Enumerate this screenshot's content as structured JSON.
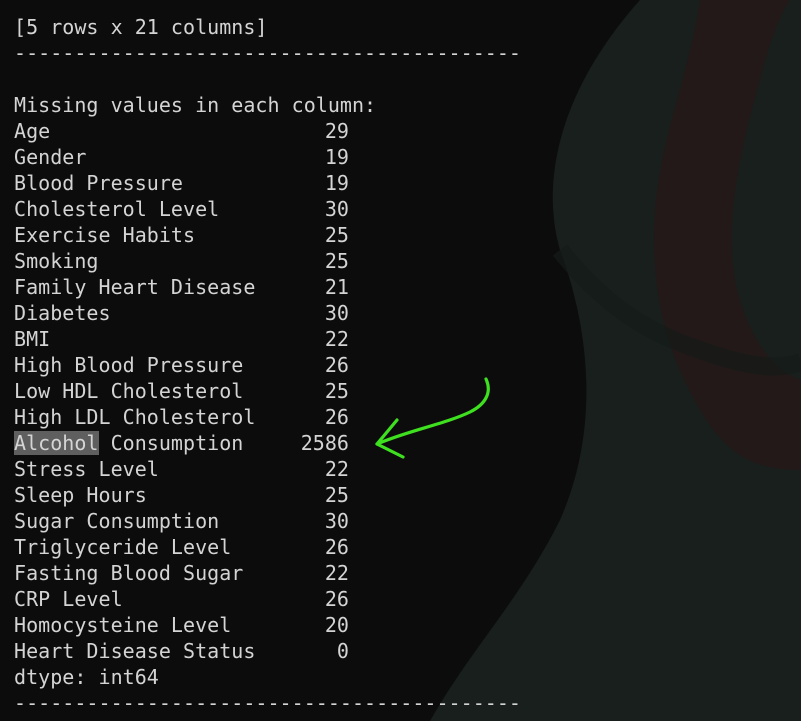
{
  "shape_line": "[5 rows x 21 columns]",
  "separator": "------------------------------------------",
  "header": "Missing values in each column:",
  "rows": [
    {
      "label": "Age",
      "value": "29"
    },
    {
      "label": "Gender",
      "value": "19"
    },
    {
      "label": "Blood Pressure",
      "value": "19"
    },
    {
      "label": "Cholesterol Level",
      "value": "30"
    },
    {
      "label": "Exercise Habits",
      "value": "25"
    },
    {
      "label": "Smoking",
      "value": "25"
    },
    {
      "label": "Family Heart Disease",
      "value": "21"
    },
    {
      "label": "Diabetes",
      "value": "30"
    },
    {
      "label": "BMI",
      "value": "22"
    },
    {
      "label": "High Blood Pressure",
      "value": "26"
    },
    {
      "label": "Low HDL Cholesterol",
      "value": "25"
    },
    {
      "label": "High LDL Cholesterol",
      "value": "26"
    },
    {
      "label": "Alcohol Consumption",
      "value": "2586",
      "highlight": "Alcohol",
      "rest": " Consumption"
    },
    {
      "label": "Stress Level",
      "value": "22"
    },
    {
      "label": "Sleep Hours",
      "value": "25"
    },
    {
      "label": "Sugar Consumption",
      "value": "30"
    },
    {
      "label": "Triglyceride Level",
      "value": "26"
    },
    {
      "label": "Fasting Blood Sugar",
      "value": "22"
    },
    {
      "label": "CRP Level",
      "value": "26"
    },
    {
      "label": "Homocysteine Level",
      "value": "20"
    },
    {
      "label": "Heart Disease Status",
      "value": "0"
    }
  ],
  "dtype": "dtype: int64",
  "colors": {
    "background": "#0c0c0c",
    "text": "#d4d4d4",
    "selection": "#5f5f5f",
    "arrow": "#3ee01f"
  },
  "annotation_icon": "green-arrow-icon"
}
